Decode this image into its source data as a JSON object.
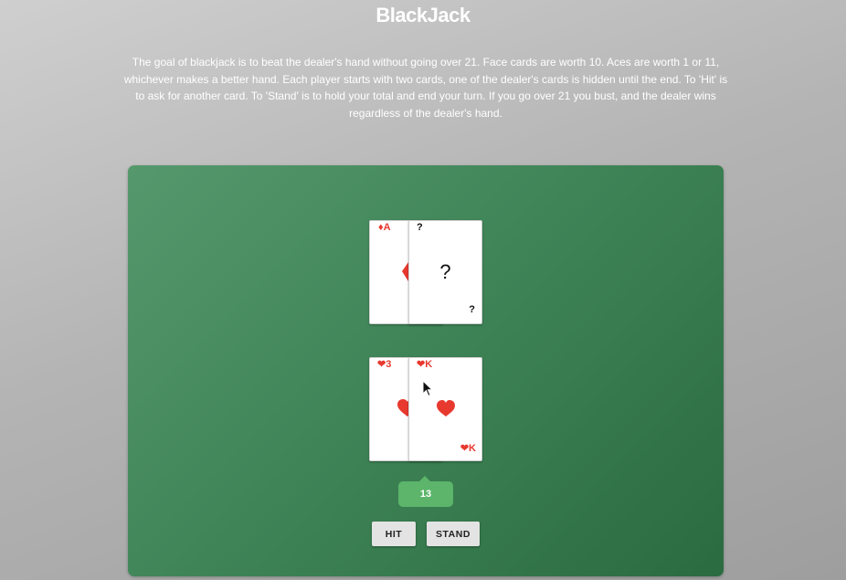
{
  "title": "BlackJack",
  "rules": "The goal of blackjack is to beat the dealer's hand without going over 21. Face cards are worth 10. Aces are worth 1 or 11, whichever makes a better hand. Each player starts with two cards, one of the dealer's cards is hidden until the end. To 'Hit' is to ask for another card. To 'Stand' is to hold your total and end your turn. If you go over 21 you bust, and the dealer wins regardless of the dealer's hand.",
  "dealer": {
    "cards": [
      {
        "suit": "♦",
        "rank": "A",
        "label": "♦A",
        "color": "#e8392f",
        "hidden": false
      },
      {
        "suit": "?",
        "rank": "?",
        "label": "?",
        "center": "?",
        "hidden": true
      }
    ]
  },
  "player": {
    "cards": [
      {
        "suit": "❤",
        "rank": "3",
        "label": "❤3",
        "color": "#e8392f"
      },
      {
        "suit": "❤",
        "rank": "K",
        "label": "❤K",
        "center": "❤",
        "color": "#e8392f"
      }
    ],
    "score": "13"
  },
  "buttons": {
    "hit": "HIT",
    "stand": "STAND"
  },
  "colors": {
    "table": "#3f8558",
    "score_badge": "#5cb56a",
    "red_suit": "#e8392f"
  }
}
